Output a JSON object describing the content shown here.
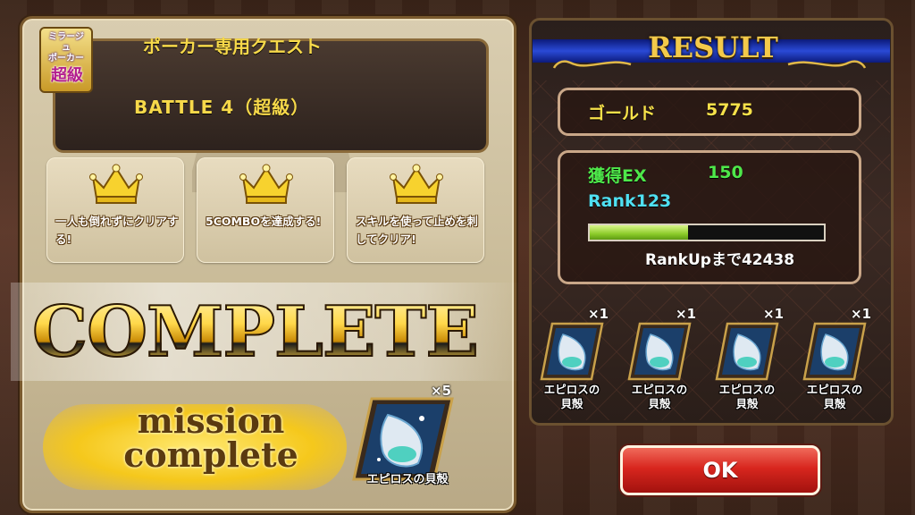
{
  "quest": {
    "badge_top": "ミラージュ\nポーカー",
    "badge_rank": "超級",
    "title": "ポーカー専用クエスト",
    "battle": "BATTLE 4（超級）"
  },
  "missions": [
    {
      "text": "一人も倒れずにクリアする!"
    },
    {
      "text": "5COMBOを達成する!"
    },
    {
      "text": "スキルを使って止めを刺してクリア!"
    }
  ],
  "banner": {
    "complete": "COMPLETE",
    "mission_line1": "mission",
    "mission_line2": "complete"
  },
  "mission_reward": {
    "count": "×5",
    "name": "エピロスの貝殻"
  },
  "result": {
    "title": "RESULT",
    "gold_label": "ゴールド",
    "gold_value": "5775",
    "ex_label": "獲得EX",
    "ex_value": "150",
    "rank_label": "Rank123",
    "rank_progress": 0.42,
    "rankup_text": "RankUpまで42438"
  },
  "items": [
    {
      "count": "×1",
      "name": "エピロスの\n貝殻"
    },
    {
      "count": "×1",
      "name": "エピロスの\n貝殻"
    },
    {
      "count": "×1",
      "name": "エピロスの\n貝殻"
    },
    {
      "count": "×1",
      "name": "エピロスの\n貝殻"
    }
  ],
  "ok_label": "OK",
  "colors": {
    "gold_text": "#f7e14a",
    "ex_green": "#4ee84a",
    "rank_cyan": "#4fe0f2",
    "ok_red": "#d8261e"
  }
}
